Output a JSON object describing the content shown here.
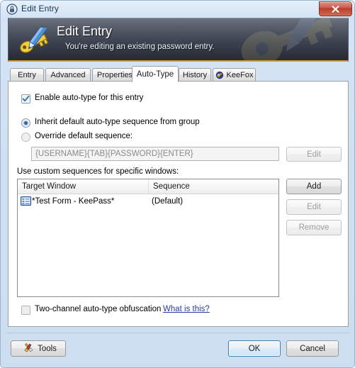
{
  "window": {
    "title": "Edit Entry",
    "title_icon": "lock-icon",
    "close_label": "Close"
  },
  "banner": {
    "title": "Edit Entry",
    "subtitle": "You're editing an existing password entry.",
    "icon": "key-pencil-icon",
    "accent_color": "#d79a35",
    "background_top": "#6d7480",
    "background_bottom": "#262b36"
  },
  "tabs": [
    {
      "label": "Entry",
      "active": false,
      "icon": ""
    },
    {
      "label": "Advanced",
      "active": false,
      "icon": ""
    },
    {
      "label": "Properties",
      "active": false,
      "icon": ""
    },
    {
      "label": "Auto-Type",
      "active": true,
      "icon": ""
    },
    {
      "label": "History",
      "active": false,
      "icon": ""
    },
    {
      "label": "KeeFox",
      "active": false,
      "icon": "keefox-globe-icon"
    }
  ],
  "autotype": {
    "enable_checkbox": {
      "label": "Enable auto-type for this entry",
      "checked": true
    },
    "inherit_radio": {
      "label": "Inherit default auto-type sequence from group",
      "selected": true
    },
    "override_radio": {
      "label": "Override default sequence:",
      "selected": false
    },
    "sequence_field": {
      "value": "{USERNAME}{TAB}{PASSWORD}{ENTER}",
      "placeholder": "{USERNAME}{TAB}{PASSWORD}{ENTER}",
      "enabled": false
    },
    "sequence_edit_button": {
      "label": "Edit",
      "enabled": false
    },
    "custom_sequences_label": "Use custom sequences for specific windows:",
    "list": {
      "columns": [
        "Target Window",
        "Sequence"
      ],
      "rows": [
        {
          "target_window": "*Test Form - KeePass*",
          "sequence": "(Default)",
          "icon": "window-list-icon"
        }
      ]
    },
    "list_buttons": [
      {
        "label": "Add",
        "enabled": true
      },
      {
        "label": "Edit",
        "enabled": false
      },
      {
        "label": "Remove",
        "enabled": false
      }
    ],
    "obfuscation_checkbox": {
      "label": "Two-channel auto-type obfuscation",
      "checked": false
    },
    "obfuscation_help_link": "What is this?"
  },
  "footer": {
    "tools_button": {
      "label": "Tools",
      "icon": "tools-icon"
    },
    "ok_button": {
      "label": "OK",
      "default": true
    },
    "cancel_button": {
      "label": "Cancel",
      "default": false
    }
  }
}
